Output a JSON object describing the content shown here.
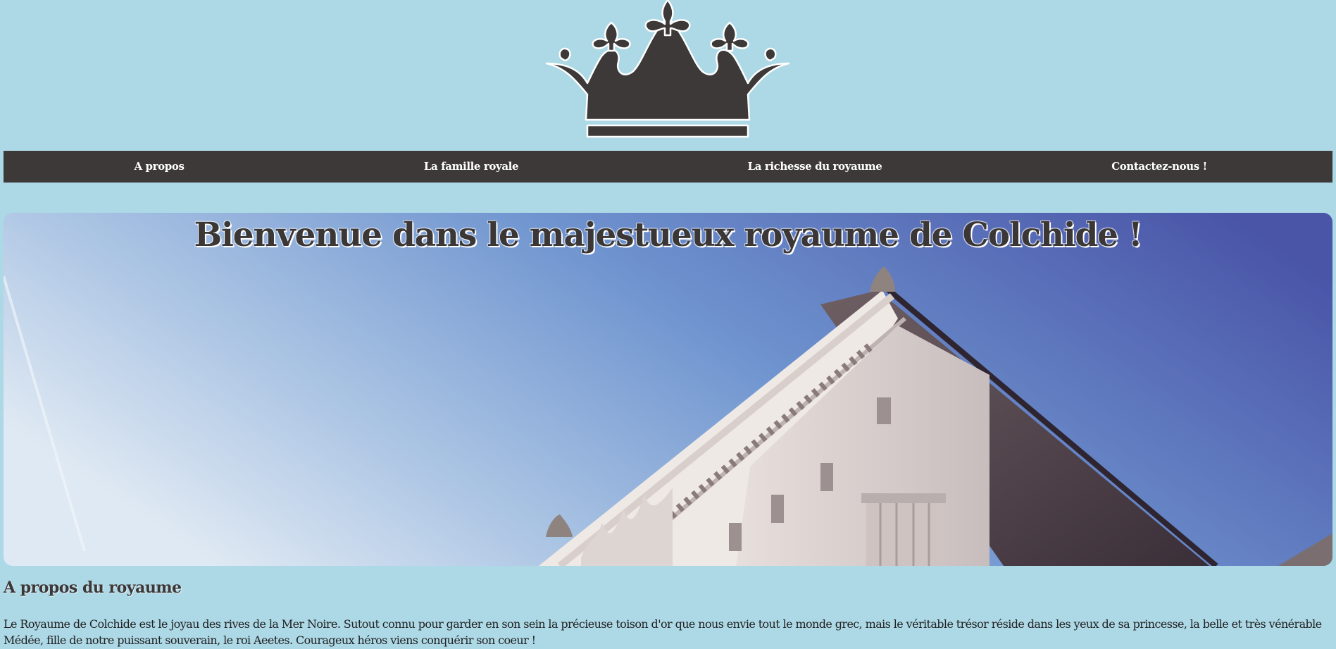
{
  "logo": {
    "icon": "crown-icon",
    "color": "#3d3939"
  },
  "nav": {
    "background": "#3d3939",
    "items": [
      {
        "label": "A propos"
      },
      {
        "label": "La famille royale"
      },
      {
        "label": "La richesse du royaume"
      },
      {
        "label": "Contactez-nous !"
      }
    ]
  },
  "hero": {
    "title": "Bienvenue dans le majestueux royaume de Colchide !",
    "image": "greek-temple-pediment-against-blue-sky"
  },
  "about": {
    "title": "A propos du royaume",
    "text": "Le Royaume de Colchide est le joyau des rives de la Mer Noire. Sutout connu pour garder en son sein la précieuse toison d'or que nous envie tout le monde grec, mais le véritable trésor réside dans les yeux de sa princesse, la belle et très vénérable Médée, fille de notre puissant souverain, le roi Aeetes. Courageux héros viens conquérir son coeur !"
  },
  "colors": {
    "page_background": "#add8e6",
    "text_dark": "#3b3737"
  }
}
